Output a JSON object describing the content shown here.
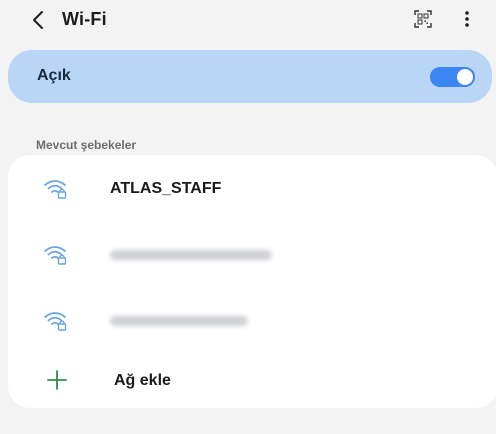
{
  "header": {
    "title": "Wi-Fi",
    "back_icon": "chevron-left-icon",
    "qr_icon": "qr-scan-icon",
    "more_icon": "more-vertical-icon"
  },
  "wifi_toggle": {
    "label": "Açık",
    "state": "on",
    "accent_color": "#3b86f0",
    "card_color": "#b9d6f6"
  },
  "networks_section": {
    "title": "Mevcut şebekeler",
    "networks": [
      {
        "ssid": "ATLAS_STAFF",
        "secured": true,
        "obscured": false
      },
      {
        "ssid": "",
        "secured": true,
        "obscured": true
      },
      {
        "ssid": "",
        "secured": true,
        "obscured": true
      }
    ],
    "add_network_label": "Ağ ekle",
    "add_color": "#2e8b4e"
  }
}
